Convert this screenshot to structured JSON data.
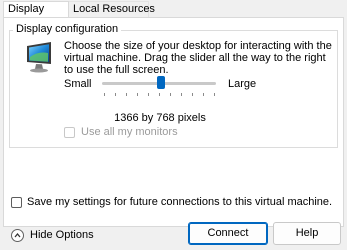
{
  "tabs": [
    {
      "label": "Display",
      "active": true
    },
    {
      "label": "Local Resources",
      "active": false
    }
  ],
  "display_config": {
    "group_title": "Display configuration",
    "icon": "monitor-icon",
    "description": "Choose the size of your desktop for interacting with the virtual machine. Drag the slider all the way to the right to use the full screen.",
    "slider": {
      "min_label": "Small",
      "max_label": "Large",
      "value_fraction": 0.52
    },
    "resolution_text": "1366 by 768 pixels",
    "all_monitors": {
      "label": "Use all my monitors",
      "checked": false,
      "enabled": false
    }
  },
  "save_settings": {
    "label": "Save my settings for future connections to this virtual machine.",
    "checked": false
  },
  "hide_options": {
    "label": "Hide Options",
    "icon": "chevron-up-icon"
  },
  "buttons": {
    "connect": "Connect",
    "help": "Help"
  },
  "colors": {
    "accent": "#0067c0",
    "disabled_text": "#9b9b9b"
  }
}
